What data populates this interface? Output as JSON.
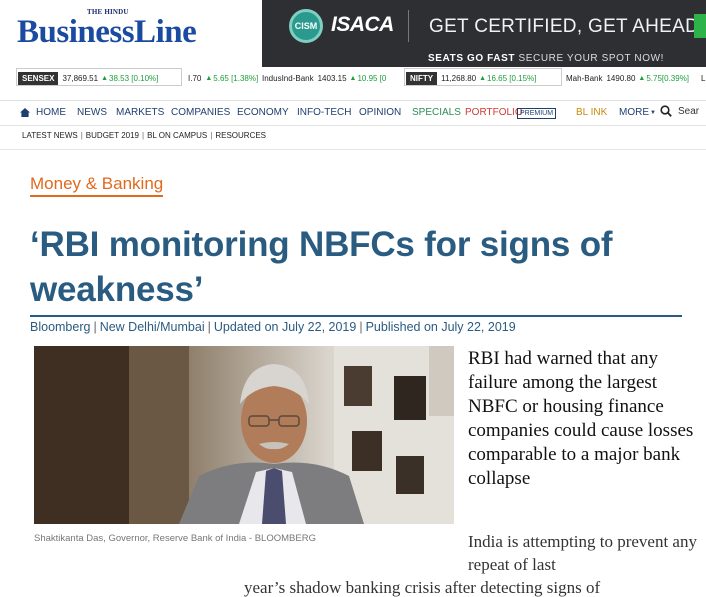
{
  "masthead": {
    "logo_pre": "THE HINDU",
    "logo_main": "BusinessLine"
  },
  "ad": {
    "cism": "CISM",
    "brand": "ISACA",
    "headline": "GET CERTIFIED, GET AHEAD",
    "sub_bold": "SEATS GO FAST",
    "sub_rest": " SECURE YOUR SPOT NOW!"
  },
  "ticker": {
    "sensex": {
      "label": "SENSEX",
      "value": "37,869.51",
      "change": "38.53 [0.10%]"
    },
    "item2": {
      "name": "I.70",
      "value": "",
      "change": "5.65 [1.38%]"
    },
    "item3": {
      "name": "IndusInd-Bank",
      "value": "1403.15",
      "change": "10.95 [0"
    },
    "nifty": {
      "label": "NIFTY",
      "value": "11,268.80",
      "change": "16.65 [0.15%]"
    },
    "item5": {
      "name": "Mah-Bank",
      "value": "1490.80",
      "change": "5.75[0.39%]"
    },
    "item6": {
      "name": "L"
    }
  },
  "nav": {
    "items": [
      "HOME",
      "NEWS",
      "MARKETS",
      "COMPANIES",
      "ECONOMY",
      "INFO-TECH",
      "OPINION",
      "SPECIALS",
      "PORTFOLIO",
      "BL INK",
      "MORE"
    ],
    "premium_badge": "PREMIUM",
    "search_label": "Sear"
  },
  "subnav": {
    "items": [
      "LATEST NEWS",
      "BUDGET 2019",
      "BL ON CAMPUS",
      "RESOURCES"
    ]
  },
  "article": {
    "section": "Money & Banking",
    "headline": "‘RBI monitoring NBFCs for signs of weakness’",
    "byline": {
      "author": "Bloomberg",
      "location": "New Delhi/Mumbai",
      "updated": "Updated on July 22, 2019",
      "published": "Published on July 22, 2019"
    },
    "photo_caption": "Shaktikanta Das, Governor, Reserve Bank of India  - BLOOMBERG",
    "summary": "RBI had warned that any failure among the largest NBFC or housing finance companies could cause losses comparable to a major bank collapse",
    "body_line1": "India is attempting to prevent any repeat of last",
    "body_line2": "year’s shadow banking crisis after detecting signs of"
  },
  "colors": {
    "brand_blue": "#1a4ba0",
    "headline_blue": "#2a5b80",
    "section_orange": "#e06a1d",
    "ticker_green": "#1e9e3a"
  }
}
